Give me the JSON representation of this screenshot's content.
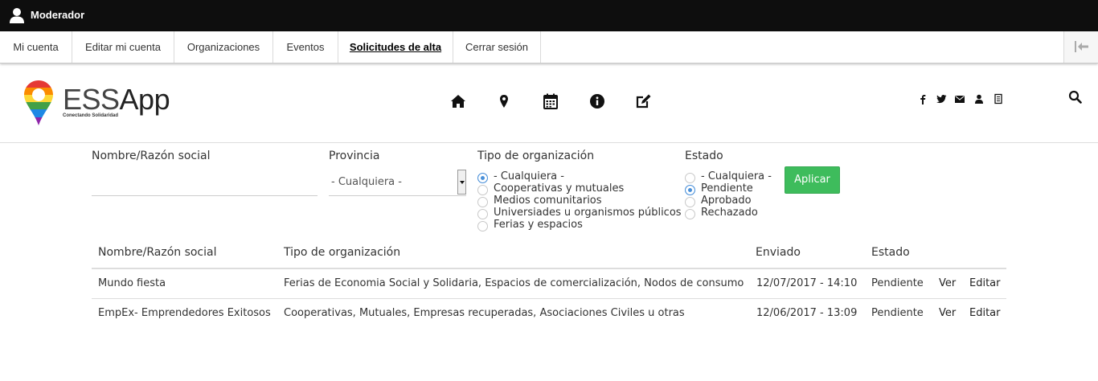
{
  "adminbar": {
    "user_label": "Moderador"
  },
  "tabs": [
    {
      "label": "Mi cuenta"
    },
    {
      "label": "Editar mi cuenta"
    },
    {
      "label": "Organizaciones"
    },
    {
      "label": "Eventos"
    },
    {
      "label": "Solicitudes de alta"
    },
    {
      "label": "Cerrar sesión"
    }
  ],
  "active_tab": "Solicitudes de alta",
  "logo": {
    "ess": "ESS",
    "app": "App",
    "tagline": "Conectando Solidaridad"
  },
  "colors": {
    "accent_green": "#3ebc5c",
    "radio_selected": "#4a90d9",
    "admin_bar": "#0e0e0e"
  },
  "nav_icons": [
    "home-icon",
    "map-marker-icon",
    "calendar-icon",
    "info-icon",
    "edit-icon"
  ],
  "social_icons": [
    "facebook-icon",
    "twitter-icon",
    "envelope-icon",
    "user-icon",
    "document-icon"
  ],
  "filters": {
    "name": {
      "label": "Nombre/Razón social",
      "value": ""
    },
    "province": {
      "label": "Provincia",
      "selected": "- Cualquiera -"
    },
    "org_type": {
      "label": "Tipo de organización",
      "options": [
        {
          "label": "- Cualquiera -",
          "selected": true
        },
        {
          "label": "Cooperativas y mutuales",
          "selected": false
        },
        {
          "label": "Medios comunitarios",
          "selected": false
        },
        {
          "label": "Universiades u organismos públicos",
          "selected": false
        },
        {
          "label": "Ferias y espacios",
          "selected": false
        }
      ]
    },
    "status": {
      "label": "Estado",
      "options": [
        {
          "label": "- Cualquiera -",
          "selected": false
        },
        {
          "label": "Pendiente",
          "selected": true
        },
        {
          "label": "Aprobado",
          "selected": false
        },
        {
          "label": "Rechazado",
          "selected": false
        }
      ]
    },
    "apply_label": "Aplicar"
  },
  "table": {
    "headers": [
      "Nombre/Razón social",
      "Tipo de organización",
      "Enviado",
      "Estado"
    ],
    "rows": [
      {
        "name": "Mundo fiesta",
        "type": "Ferias de Economia Social y Solidaria, Espacios de comercialización, Nodos de consumo",
        "sent": "12/07/2017 - 14:10",
        "status": "Pendiente",
        "view": "Ver",
        "edit": "Editar"
      },
      {
        "name": "EmpEx- Emprendedores Exitosos",
        "type": "Cooperativas, Mutuales, Empresas recuperadas, Asociaciones Civiles u otras",
        "sent": "12/06/2017 - 13:09",
        "status": "Pendiente",
        "view": "Ver",
        "edit": "Editar"
      }
    ]
  }
}
